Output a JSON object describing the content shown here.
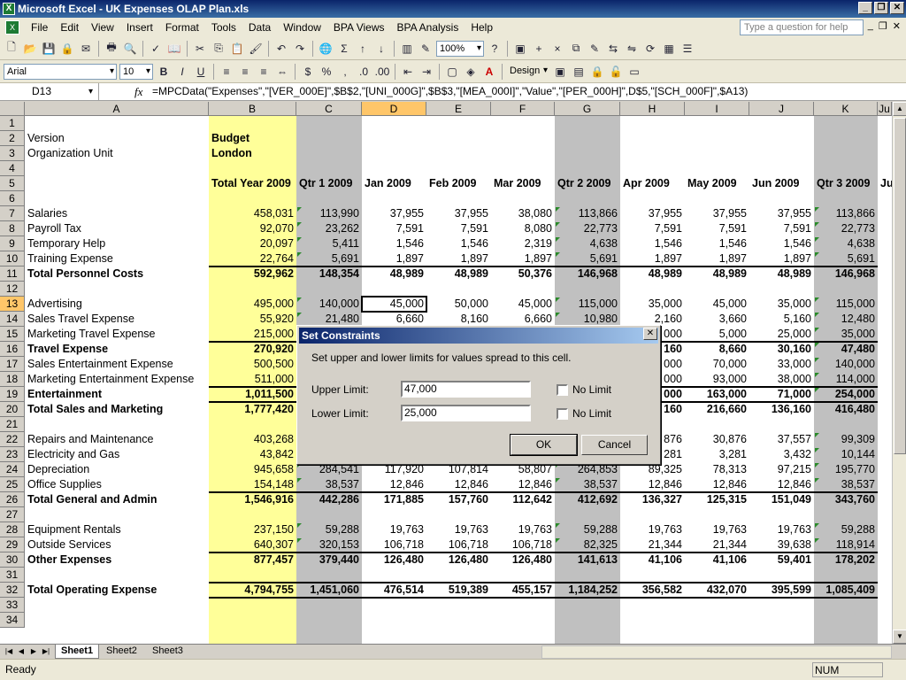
{
  "window": {
    "title": "Microsoft Excel - UK Expenses OLAP Plan.xls"
  },
  "menu": [
    "File",
    "Edit",
    "View",
    "Insert",
    "Format",
    "Tools",
    "Data",
    "Window",
    "BPA Views",
    "BPA Analysis",
    "Help"
  ],
  "help_placeholder": "Type a question for help",
  "toolbar": {
    "zoom": "100%",
    "font": "Arial",
    "size": "10",
    "design": "Design"
  },
  "formula_bar": {
    "name_box": "D13",
    "fx": "fx",
    "formula": "=MPCData(\"Expenses\",\"[VER_000E]\",$B$2,\"[UNI_000G]\",$B$3,\"[MEA_000I]\",\"Value\",\"[PER_000H]\",D$5,\"[SCH_000F]\",$A13)"
  },
  "columns": [
    "A",
    "B",
    "C",
    "D",
    "E",
    "F",
    "G",
    "H",
    "I",
    "J",
    "K",
    "Ju"
  ],
  "row_numbers": [
    "1",
    "2",
    "3",
    "4",
    "5",
    "6",
    "7",
    "8",
    "9",
    "10",
    "11",
    "12",
    "13",
    "14",
    "15",
    "16",
    "17",
    "18",
    "19",
    "20",
    "21",
    "22",
    "23",
    "24",
    "25",
    "26",
    "27",
    "28",
    "29",
    "30",
    "31",
    "32",
    "33",
    "34"
  ],
  "header_labels": {
    "version_label": "Version",
    "version": "Budget",
    "org_label": "Organization Unit",
    "org": "London"
  },
  "period_headers": [
    "Total Year 2009",
    "Qtr 1 2009",
    "Jan 2009",
    "Feb 2009",
    "Mar 2009",
    "Qtr 2 2009",
    "Apr 2009",
    "May 2009",
    "Jun 2009",
    "Qtr 3 2009",
    "Ju"
  ],
  "rows": [
    {
      "r": 7,
      "label": "Salaries",
      "vals": [
        "458,031",
        "113,990",
        "37,955",
        "37,955",
        "38,080",
        "113,866",
        "37,955",
        "37,955",
        "37,955",
        "113,866"
      ]
    },
    {
      "r": 8,
      "label": "Payroll Tax",
      "vals": [
        "92,070",
        "23,262",
        "7,591",
        "7,591",
        "8,080",
        "22,773",
        "7,591",
        "7,591",
        "7,591",
        "22,773"
      ]
    },
    {
      "r": 9,
      "label": "Temporary Help",
      "vals": [
        "20,097",
        "5,411",
        "1,546",
        "1,546",
        "2,319",
        "4,638",
        "1,546",
        "1,546",
        "1,546",
        "4,638"
      ]
    },
    {
      "r": 10,
      "label": "Training Expense",
      "vals": [
        "22,764",
        "5,691",
        "1,897",
        "1,897",
        "1,897",
        "5,691",
        "1,897",
        "1,897",
        "1,897",
        "5,691"
      ]
    },
    {
      "r": 11,
      "label": "Total Personnel Costs",
      "bold": true,
      "vals": [
        "592,962",
        "148,354",
        "48,989",
        "48,989",
        "50,376",
        "146,968",
        "48,989",
        "48,989",
        "48,989",
        "146,968"
      ]
    },
    {
      "r": 13,
      "label": "Advertising",
      "vals": [
        "495,000",
        "140,000",
        "45,000",
        "50,000",
        "45,000",
        "115,000",
        "35,000",
        "45,000",
        "35,000",
        "115,000"
      ]
    },
    {
      "r": 14,
      "label": "Sales Travel Expense",
      "vals": [
        "55,920",
        "21,480",
        "6,660",
        "8,160",
        "6,660",
        "10,980",
        "2,160",
        "3,660",
        "5,160",
        "12,480"
      ]
    },
    {
      "r": 15,
      "label": "Marketing Travel Expense",
      "vals": [
        "215,000",
        "",
        "",
        "",
        "",
        "",
        "000",
        "5,000",
        "25,000",
        "35,000"
      ]
    },
    {
      "r": 16,
      "label": "Travel Expense",
      "bold": true,
      "vals": [
        "270,920",
        "",
        "",
        "",
        "",
        "",
        "160",
        "8,660",
        "30,160",
        "47,480"
      ]
    },
    {
      "r": 17,
      "label": "Sales Entertainment Expense",
      "vals": [
        "500,500",
        "",
        "",
        "",
        "",
        "",
        "000",
        "70,000",
        "33,000",
        "140,000"
      ]
    },
    {
      "r": 18,
      "label": "Marketing Entertainment Expense",
      "vals": [
        "511,000",
        "",
        "",
        "",
        "",
        "",
        "000",
        "93,000",
        "38,000",
        "114,000"
      ]
    },
    {
      "r": 19,
      "label": "Entertainment",
      "bold": true,
      "vals": [
        "1,011,500",
        "",
        "",
        "",
        "",
        "",
        "000",
        "163,000",
        "71,000",
        "254,000"
      ]
    },
    {
      "r": 20,
      "label": "Total Sales and Marketing",
      "bold": true,
      "vals": [
        "1,777,420",
        "",
        "",
        "",
        "",
        "",
        "160",
        "216,660",
        "136,160",
        "416,480"
      ]
    },
    {
      "r": 22,
      "label": "Repairs and Maintenance",
      "vals": [
        "403,268",
        "",
        "",
        "",
        "",
        "",
        "876",
        "30,876",
        "37,557",
        "99,309"
      ]
    },
    {
      "r": 23,
      "label": "Electricity and  Gas",
      "vals": [
        "43,842",
        "",
        "",
        "",
        "",
        "",
        "281",
        "3,281",
        "3,432",
        "10,144"
      ]
    },
    {
      "r": 24,
      "label": "Depreciation",
      "vals": [
        "945,658",
        "284,541",
        "117,920",
        "107,814",
        "58,807",
        "264,853",
        "89,325",
        "78,313",
        "97,215",
        "195,770"
      ]
    },
    {
      "r": 25,
      "label": "Office Supplies",
      "vals": [
        "154,148",
        "38,537",
        "12,846",
        "12,846",
        "12,846",
        "38,537",
        "12,846",
        "12,846",
        "12,846",
        "38,537"
      ]
    },
    {
      "r": 26,
      "label": "Total General and Admin",
      "bold": true,
      "vals": [
        "1,546,916",
        "442,286",
        "171,885",
        "157,760",
        "112,642",
        "412,692",
        "136,327",
        "125,315",
        "151,049",
        "343,760"
      ]
    },
    {
      "r": 28,
      "label": "Equipment Rentals",
      "vals": [
        "237,150",
        "59,288",
        "19,763",
        "19,763",
        "19,763",
        "59,288",
        "19,763",
        "19,763",
        "19,763",
        "59,288"
      ]
    },
    {
      "r": 29,
      "label": "Outside Services",
      "vals": [
        "640,307",
        "320,153",
        "106,718",
        "106,718",
        "106,718",
        "82,325",
        "21,344",
        "21,344",
        "39,638",
        "118,914"
      ]
    },
    {
      "r": 30,
      "label": "Other Expenses",
      "bold": true,
      "vals": [
        "877,457",
        "379,440",
        "126,480",
        "126,480",
        "126,480",
        "141,613",
        "41,106",
        "41,106",
        "59,401",
        "178,202"
      ]
    },
    {
      "r": 32,
      "label": "Total Operating Expense",
      "bold": true,
      "vals": [
        "4,794,755",
        "1,451,060",
        "476,514",
        "519,389",
        "455,157",
        "1,184,252",
        "356,582",
        "432,070",
        "395,599",
        "1,085,409"
      ]
    }
  ],
  "sheets": [
    "Sheet1",
    "Sheet2",
    "Sheet3"
  ],
  "status": {
    "ready": "Ready",
    "num": "NUM"
  },
  "dialog": {
    "title": "Set Constraints",
    "description": "Set upper and lower limits for values spread to this cell.",
    "upper_label": "Upper Limit:",
    "upper_value": "47,000",
    "lower_label": "Lower Limit:",
    "lower_value": "25,000",
    "no_limit": "No Limit",
    "ok": "OK",
    "cancel": "Cancel"
  },
  "colors": {
    "total_year": "#ffff99",
    "quarter": "#c0c0c0",
    "selected_header": "#ffc669"
  }
}
